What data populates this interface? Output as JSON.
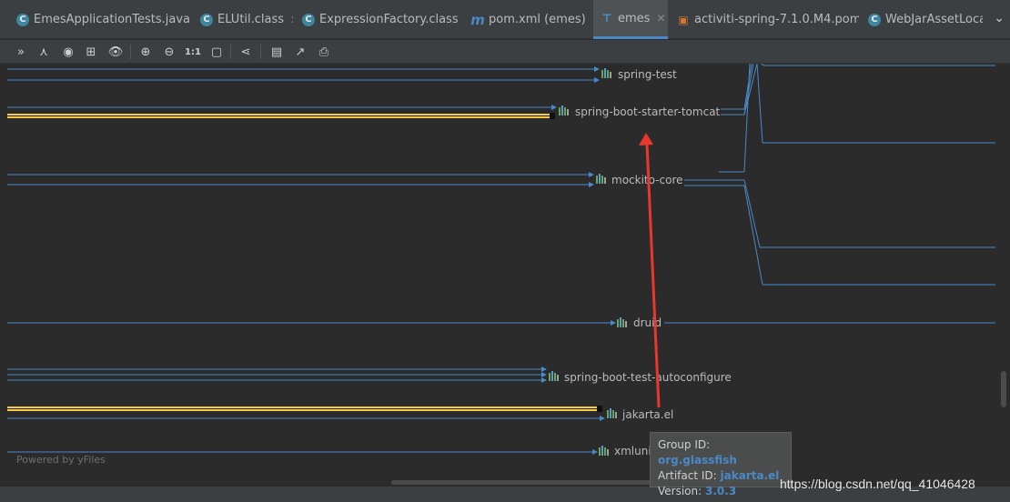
{
  "tabs": [
    {
      "label": "EmesApplicationTests.java",
      "icon": "class-icon"
    },
    {
      "label": "ELUtil.class",
      "icon": "class-icon"
    },
    {
      "label": "ExpressionFactory.class",
      "icon": "class-icon"
    },
    {
      "label": "pom.xml (emes)",
      "icon": "maven-icon"
    },
    {
      "label": "emes",
      "icon": "graph-icon",
      "active": true
    },
    {
      "label": "activiti-spring-7.1.0.M4.pom",
      "icon": "pom-icon"
    },
    {
      "label": "WebJarAssetLocat",
      "icon": "class-icon"
    }
  ],
  "toolbar_icons": [
    "collapse-icon",
    "layout-icon",
    "fit-content-icon",
    "actual-size-icon",
    "eye-icon",
    "zoom-in-icon",
    "zoom-out-icon",
    "one-to-one-icon",
    "fit-icon",
    "hierarchy-icon",
    "save-icon",
    "export-icon",
    "print-icon"
  ],
  "toolbar": {
    "one_to_one": "1:1"
  },
  "graph": {
    "nodes": [
      "spring-test",
      "spring-boot-starter-tomcat",
      "mockito-core",
      "druid",
      "spring-boot-test-autoconfigure",
      "jakarta.el",
      "xmlunit"
    ],
    "highlight_color": "#f7c948",
    "edge_color": "#4a88c7"
  },
  "watermark": "Powered by yFiles",
  "tooltip": {
    "group_label": "Group ID:",
    "group_value": "org.glassfish",
    "artifact_label": "Artifact ID:",
    "artifact_value": "jakarta.el",
    "version_label": "Version:",
    "version_value": "3.0.3"
  },
  "credit": "https://blog.csdn.net/qq_41046428",
  "annotation_color": "#e8372c"
}
